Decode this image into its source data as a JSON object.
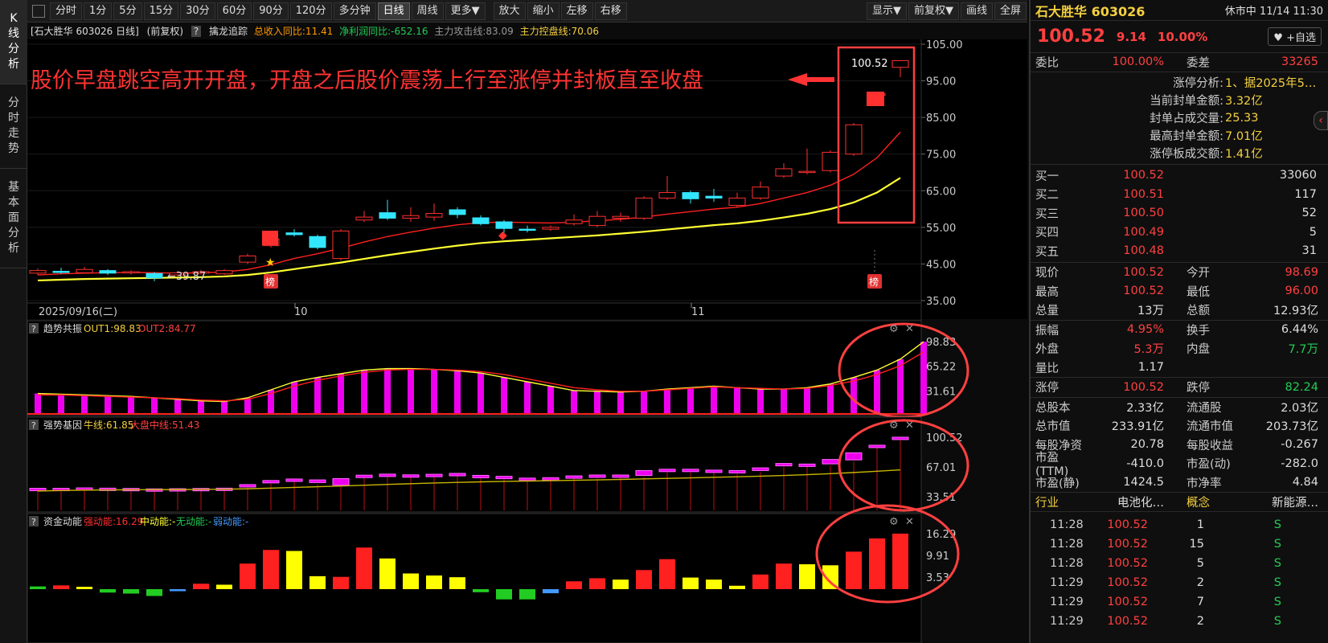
{
  "left_tabs": [
    "K\n线\n分\n析",
    "分\n时\n走\n势",
    "基\n本\n面\n分\n析"
  ],
  "toolbar": {
    "periods": [
      "分时",
      "1分",
      "5分",
      "15分",
      "30分",
      "60分",
      "90分",
      "120分",
      "多分钟",
      "日线",
      "周线",
      "更多▼"
    ],
    "active_period": "日线",
    "actions": [
      "放大",
      "缩小",
      "左移",
      "右移"
    ],
    "right": [
      "显示▼",
      "前复权▼",
      "画线",
      "全屏"
    ]
  },
  "infoline": {
    "stock": "[石大胜华 603026 日线]",
    "adj": "(前复权)",
    "q": "?",
    "indicator": "擒龙追踪",
    "rev": "总收入同比:11.41",
    "profit": "净利润同比:-652.16",
    "atk": "主力攻击线:83.09",
    "ctrl": "主力控盘线:70.06"
  },
  "annotation": "股价早盘跳空高开开盘，开盘之后股价震荡上行至涨停并封板直至收盘",
  "main_chart": {
    "y_ticks": [
      "105.00",
      "95.00",
      "85.00",
      "75.00",
      "65.00",
      "55.00",
      "45.00",
      "35.00"
    ],
    "x_labels": [
      "2025/09/16(二)",
      "10",
      "11"
    ],
    "low_label": "39.87",
    "high_label": "100.52",
    "bang": "榜"
  },
  "chart_data": {
    "type": "candlestick",
    "ylim": [
      35,
      105
    ],
    "candles": [
      {
        "o": 42.5,
        "c": 43.2,
        "h": 43.8,
        "l": 42.0
      },
      {
        "o": 43.0,
        "c": 42.8,
        "h": 44.0,
        "l": 42.3
      },
      {
        "o": 42.6,
        "c": 43.5,
        "h": 44.2,
        "l": 42.4
      },
      {
        "o": 43.2,
        "c": 42.5,
        "h": 43.6,
        "l": 42.0
      },
      {
        "o": 42.6,
        "c": 42.9,
        "h": 43.3,
        "l": 42.1
      },
      {
        "o": 42.4,
        "c": 41.2,
        "h": 42.8,
        "l": 40.3
      },
      {
        "o": 42.0,
        "c": 42.6,
        "h": 43.1,
        "l": 41.7
      },
      {
        "o": 42.5,
        "c": 42.9,
        "h": 43.4,
        "l": 42.1
      },
      {
        "o": 42.3,
        "c": 43.2,
        "h": 43.6,
        "l": 42.0
      },
      {
        "o": 45.5,
        "c": 47.2,
        "h": 47.8,
        "l": 45.0
      },
      {
        "o": 50.0,
        "c": 51.8,
        "h": 52.5,
        "l": 49.5
      },
      {
        "o": 53.5,
        "c": 53.0,
        "h": 54.5,
        "l": 52.5
      },
      {
        "o": 52.5,
        "c": 49.5,
        "h": 53.0,
        "l": 49.0
      },
      {
        "o": 46.5,
        "c": 54.0,
        "h": 54.5,
        "l": 46.0
      },
      {
        "o": 57.0,
        "c": 57.8,
        "h": 59.5,
        "l": 56.5
      },
      {
        "o": 59.0,
        "c": 57.5,
        "h": 62.5,
        "l": 57.0
      },
      {
        "o": 57.5,
        "c": 58.2,
        "h": 60.5,
        "l": 56.5
      },
      {
        "o": 57.8,
        "c": 58.8,
        "h": 61.5,
        "l": 56.8
      },
      {
        "o": 59.8,
        "c": 58.5,
        "h": 60.5,
        "l": 57.5
      },
      {
        "o": 57.6,
        "c": 56.0,
        "h": 58.3,
        "l": 55.5
      },
      {
        "o": 56.5,
        "c": 54.7,
        "h": 57.0,
        "l": 53.5
      },
      {
        "o": 54.5,
        "c": 54.2,
        "h": 55.5,
        "l": 53.6
      },
      {
        "o": 54.5,
        "c": 55.0,
        "h": 55.5,
        "l": 54.0
      },
      {
        "o": 56.0,
        "c": 57.0,
        "h": 58.5,
        "l": 55.5
      },
      {
        "o": 55.5,
        "c": 58.0,
        "h": 59.5,
        "l": 55.0
      },
      {
        "o": 57.5,
        "c": 58.0,
        "h": 59.0,
        "l": 56.5
      },
      {
        "o": 57.5,
        "c": 63.0,
        "h": 63.5,
        "l": 57.0
      },
      {
        "o": 63.0,
        "c": 64.5,
        "h": 69.0,
        "l": 62.5
      },
      {
        "o": 64.5,
        "c": 62.8,
        "h": 65.0,
        "l": 61.5
      },
      {
        "o": 63.5,
        "c": 63.0,
        "h": 65.5,
        "l": 62.0
      },
      {
        "o": 61.0,
        "c": 63.0,
        "h": 64.5,
        "l": 60.5
      },
      {
        "o": 63.0,
        "c": 66.0,
        "h": 67.5,
        "l": 62.5
      },
      {
        "o": 69.0,
        "c": 71.0,
        "h": 72.5,
        "l": 68.5
      },
      {
        "o": 70.0,
        "c": 70.3,
        "h": 76.5,
        "l": 69.5
      },
      {
        "o": 70.5,
        "c": 75.5,
        "h": 76.0,
        "l": 70.0
      },
      {
        "o": 75.0,
        "c": 83.0,
        "h": 83.5,
        "l": 74.5
      },
      {
        "o": 91.0,
        "c": 91.5,
        "h": 91.8,
        "l": 88.5
      },
      {
        "o": 98.69,
        "c": 100.52,
        "h": 100.52,
        "l": 96.0
      }
    ],
    "ma_short": [
      42.0,
      42.3,
      42.5,
      42.6,
      42.7,
      42.6,
      42.5,
      42.6,
      42.8,
      43.5,
      44.8,
      46.5,
      47.8,
      49.3,
      51.0,
      52.5,
      53.7,
      54.8,
      55.7,
      56.3,
      56.4,
      56.3,
      56.2,
      56.4,
      56.8,
      57.2,
      57.8,
      58.6,
      59.3,
      60.0,
      60.5,
      61.5,
      63.0,
      64.5,
      66.5,
      69.5,
      74.0,
      81.0
    ],
    "ma_long": [
      40.5,
      40.7,
      40.9,
      41.0,
      41.1,
      41.2,
      41.3,
      41.4,
      41.6,
      42.0,
      42.7,
      43.6,
      44.5,
      45.4,
      46.4,
      47.4,
      48.3,
      49.2,
      50.0,
      50.7,
      51.2,
      51.6,
      52.0,
      52.4,
      52.8,
      53.3,
      53.8,
      54.4,
      55.0,
      55.6,
      56.1,
      56.8,
      57.7,
      58.7,
      60.0,
      61.8,
      64.5,
      68.5
    ],
    "ind1_name": "趋势共振",
    "ind1_out1": "OUT1:98.83",
    "ind1_out2": "OUT2:84.77",
    "ind1_ticks": [
      "98.83",
      "65.22",
      "31.61"
    ],
    "ind1_bars": [
      28,
      27,
      26,
      25,
      24,
      22,
      20,
      18,
      17,
      22,
      33,
      44,
      50,
      55,
      60,
      62,
      62,
      61,
      59,
      56,
      50,
      44,
      38,
      32,
      31,
      30,
      31,
      34,
      36,
      38,
      36,
      34,
      34,
      36,
      41,
      50,
      60,
      75,
      98.83
    ],
    "ind1_line1": [
      28,
      27,
      26,
      25,
      24,
      22,
      20,
      18,
      17,
      22,
      33,
      44,
      50,
      55,
      60,
      62,
      62,
      61,
      59,
      56,
      50,
      44,
      38,
      32,
      31,
      30,
      31,
      34,
      36,
      38,
      36,
      34,
      34,
      36,
      41,
      50,
      60,
      75,
      98.83
    ],
    "ind1_line2": [
      26,
      26,
      25,
      24,
      23,
      22,
      21,
      19,
      18,
      20,
      28,
      38,
      46,
      52,
      57,
      60,
      61,
      61,
      60,
      58,
      54,
      48,
      42,
      36,
      33,
      31,
      31,
      33,
      35,
      37,
      36,
      35,
      34,
      35,
      39,
      45,
      54,
      66,
      84.77
    ],
    "ind2_name": "强势基因",
    "ind2_l1": "牛线:61.85",
    "ind2_l2": "大盘中线:51.43",
    "ind2_ticks": [
      "100.52",
      "67.01",
      "33.51"
    ],
    "ind2_boxes": [
      {
        "o": 42,
        "c": 43
      },
      {
        "o": 43,
        "c": 43
      },
      {
        "o": 42.6,
        "c": 43.5
      },
      {
        "o": 43.2,
        "c": 42.5
      },
      {
        "o": 42.6,
        "c": 42.9
      },
      {
        "o": 42.4,
        "c": 41.2
      },
      {
        "o": 42,
        "c": 42.6
      },
      {
        "o": 42.5,
        "c": 42.9
      },
      {
        "o": 42.3,
        "c": 43.2
      },
      {
        "o": 45.5,
        "c": 47.2
      },
      {
        "o": 50,
        "c": 51.8
      },
      {
        "o": 53.5,
        "c": 53
      },
      {
        "o": 52.5,
        "c": 49.5
      },
      {
        "o": 46.5,
        "c": 54
      },
      {
        "o": 57,
        "c": 57.8
      },
      {
        "o": 59,
        "c": 57.5
      },
      {
        "o": 57.5,
        "c": 58.2
      },
      {
        "o": 57.8,
        "c": 58.8
      },
      {
        "o": 59.8,
        "c": 58.5
      },
      {
        "o": 57.6,
        "c": 56
      },
      {
        "o": 56.5,
        "c": 54.7
      },
      {
        "o": 54.5,
        "c": 54.2
      },
      {
        "o": 54.5,
        "c": 55
      },
      {
        "o": 56,
        "c": 57
      },
      {
        "o": 55.5,
        "c": 58
      },
      {
        "o": 57.5,
        "c": 58
      },
      {
        "o": 57.5,
        "c": 63
      },
      {
        "o": 63,
        "c": 64.5
      },
      {
        "o": 64.5,
        "c": 62.8
      },
      {
        "o": 63.5,
        "c": 63
      },
      {
        "o": 61,
        "c": 63
      },
      {
        "o": 63,
        "c": 66
      },
      {
        "o": 69,
        "c": 71
      },
      {
        "o": 70,
        "c": 70.3
      },
      {
        "o": 70.5,
        "c": 75.5
      },
      {
        "o": 75,
        "c": 83
      },
      {
        "o": 91,
        "c": 91.5
      },
      {
        "o": 98.69,
        "c": 100.52
      }
    ],
    "ind2_line": [
      40,
      40.5,
      41,
      41.2,
      41.4,
      41.5,
      41.6,
      41.8,
      42,
      42.5,
      43.2,
      44,
      44.8,
      45.6,
      46.5,
      47.4,
      48.2,
      49,
      49.7,
      50.3,
      50.8,
      51.2,
      51.6,
      52,
      52.5,
      53,
      53.6,
      54.2,
      54.8,
      55.4,
      56,
      56.7,
      57.5,
      58.4,
      59.5,
      60.8,
      62.2,
      63.8
    ],
    "ind3_name": "资金动能",
    "ind3_strong": "强动能:16.29",
    "ind3_mid": "中动能:-",
    "ind3_none": "无动能:-",
    "ind3_weak": "弱动能:-",
    "ind3_ticks": [
      "16.29",
      "9.91",
      "3.53"
    ],
    "ind3_bars": [
      {
        "v": 0.8,
        "c": "#22cc22"
      },
      {
        "v": 1.1,
        "c": "#ff2020"
      },
      {
        "v": 0.7,
        "c": "#ffff00"
      },
      {
        "v": -1.0,
        "c": "#22cc22"
      },
      {
        "v": -1.3,
        "c": "#22cc22"
      },
      {
        "v": -2.0,
        "c": "#22cc22"
      },
      {
        "v": -0.6,
        "c": "#4499ff"
      },
      {
        "v": 1.6,
        "c": "#ff2020"
      },
      {
        "v": 1.3,
        "c": "#ffff00"
      },
      {
        "v": 7.5,
        "c": "#ff2020"
      },
      {
        "v": 11.5,
        "c": "#ff2020"
      },
      {
        "v": 11.2,
        "c": "#ffff00"
      },
      {
        "v": 3.8,
        "c": "#ffff00"
      },
      {
        "v": 3.6,
        "c": "#ff2020"
      },
      {
        "v": 12.2,
        "c": "#ff2020"
      },
      {
        "v": 9.0,
        "c": "#ffff00"
      },
      {
        "v": 4.6,
        "c": "#ffff00"
      },
      {
        "v": 4.0,
        "c": "#ffff00"
      },
      {
        "v": 3.5,
        "c": "#ffff00"
      },
      {
        "v": -0.9,
        "c": "#22cc22"
      },
      {
        "v": -3.0,
        "c": "#22cc22"
      },
      {
        "v": -3.0,
        "c": "#22cc22"
      },
      {
        "v": -1.2,
        "c": "#4499ff"
      },
      {
        "v": 2.3,
        "c": "#ff2020"
      },
      {
        "v": 3.2,
        "c": "#ff2020"
      },
      {
        "v": 2.8,
        "c": "#ffff00"
      },
      {
        "v": 5.6,
        "c": "#ff2020"
      },
      {
        "v": 8.8,
        "c": "#ff2020"
      },
      {
        "v": 3.4,
        "c": "#ffff00"
      },
      {
        "v": 2.8,
        "c": "#ffff00"
      },
      {
        "v": 1.0,
        "c": "#ffff00"
      },
      {
        "v": 4.3,
        "c": "#ff2020"
      },
      {
        "v": 7.5,
        "c": "#ff2020"
      },
      {
        "v": 7.3,
        "c": "#ffff00"
      },
      {
        "v": 7.0,
        "c": "#ffff00"
      },
      {
        "v": 11.0,
        "c": "#ff2020"
      },
      {
        "v": 14.9,
        "c": "#ff2020"
      },
      {
        "v": 16.29,
        "c": "#ff2020"
      }
    ]
  },
  "right": {
    "name": "石大胜华 603026",
    "status": "休市中 11/14 11:30",
    "price": "100.52",
    "chg": "9.14",
    "pct": "10.00%",
    "fav": "+自选",
    "weibi_k": "委比",
    "weibi_v": "100.00%",
    "weicha_k": "委差",
    "weicha_v": "33265",
    "zt": [
      {
        "k": "涨停分析:",
        "v": "1、据2025年5…"
      },
      {
        "k": "当前封单金额:",
        "v": "3.32亿"
      },
      {
        "k": "封单占成交量:",
        "v": "25.33"
      },
      {
        "k": "最高封单金额:",
        "v": "7.01亿"
      },
      {
        "k": "涨停板成交额:",
        "v": "1.41亿"
      }
    ],
    "bids": [
      {
        "k": "买一",
        "p": "100.52",
        "v": "33060"
      },
      {
        "k": "买二",
        "p": "100.51",
        "v": "117"
      },
      {
        "k": "买三",
        "p": "100.50",
        "v": "52"
      },
      {
        "k": "买四",
        "p": "100.49",
        "v": "5"
      },
      {
        "k": "买五",
        "p": "100.48",
        "v": "31"
      }
    ],
    "q1": [
      {
        "a": "现价",
        "b": "100.52",
        "bc": "red",
        "c": "今开",
        "d": "98.69",
        "dc": "red"
      },
      {
        "a": "最高",
        "b": "100.52",
        "bc": "red",
        "c": "最低",
        "d": "96.00",
        "dc": "red"
      },
      {
        "a": "总量",
        "b": "13万",
        "bc": "white",
        "c": "总额",
        "d": "12.93亿",
        "dc": "white"
      }
    ],
    "q2": [
      {
        "a": "振幅",
        "b": "4.95%",
        "bc": "red",
        "c": "换手",
        "d": "6.44%",
        "dc": "white"
      },
      {
        "a": "外盘",
        "b": "5.3万",
        "bc": "red",
        "c": "内盘",
        "d": "7.7万",
        "dc": "green"
      },
      {
        "a": "量比",
        "b": "1.17",
        "bc": "white",
        "c": "",
        "d": "",
        "dc": "white"
      }
    ],
    "q3": [
      {
        "a": "涨停",
        "b": "100.52",
        "bc": "red",
        "c": "跌停",
        "d": "82.24",
        "dc": "green"
      }
    ],
    "q4": [
      {
        "a": "总股本",
        "b": "2.33亿",
        "bc": "white",
        "c": "流通股",
        "d": "2.03亿",
        "dc": "white"
      },
      {
        "a": "总市值",
        "b": "233.91亿",
        "bc": "white",
        "c": "流通市值",
        "d": "203.73亿",
        "dc": "white"
      },
      {
        "a": "每股净资",
        "b": "20.78",
        "bc": "white",
        "c": "每股收益",
        "d": "-0.267",
        "dc": "white"
      },
      {
        "a": "市盈(TTM)",
        "b": "-410.0",
        "bc": "white",
        "c": "市盈(动)",
        "d": "-282.0",
        "dc": "white"
      },
      {
        "a": "市盈(静)",
        "b": "1424.5",
        "bc": "white",
        "c": "市净率",
        "d": "4.84",
        "dc": "white"
      }
    ],
    "industry": {
      "a": "行业",
      "b": "电池化…",
      "c": "概念",
      "d": "新能源…"
    },
    "ticks": [
      {
        "t": "11:28",
        "p": "100.52",
        "v": "1",
        "s": "S"
      },
      {
        "t": "11:28",
        "p": "100.52",
        "v": "15",
        "s": "S"
      },
      {
        "t": "11:28",
        "p": "100.52",
        "v": "5",
        "s": "S"
      },
      {
        "t": "11:29",
        "p": "100.52",
        "v": "2",
        "s": "S"
      },
      {
        "t": "11:29",
        "p": "100.52",
        "v": "7",
        "s": "S"
      },
      {
        "t": "11:29",
        "p": "100.52",
        "v": "2",
        "s": "S"
      }
    ]
  }
}
